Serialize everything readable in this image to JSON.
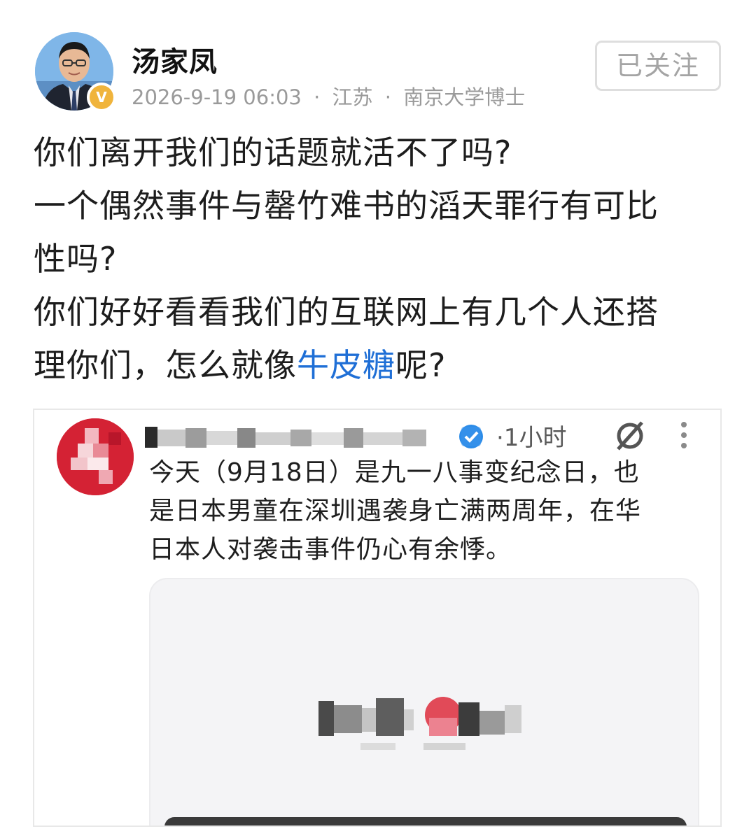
{
  "author": {
    "name": "汤家凤",
    "verified_badge": "V",
    "date": "2026-9-19 06:03",
    "separator": "·",
    "location": "江苏",
    "title": "南京大学博士",
    "follow_label": "已关注"
  },
  "post": {
    "lines": [
      "你们离开我们的话题就活不了吗?",
      "一个偶然事件与罄竹难书的滔天罪行有可比",
      "性吗?",
      "你们好好看看我们的互联网上有几个人还搭"
    ],
    "last_line_prefix": "理你们，怎么就像",
    "topic_link": "牛皮糖",
    "last_line_suffix": "呢?"
  },
  "embed": {
    "time": "·1小时",
    "text_lines": [
      "今天（9月18日）是九一八事变纪念日，也",
      "是日本男童在深圳遇袭身亡满两周年，在华",
      "日本人对袭击事件仍心有余悸。"
    ],
    "icons": {
      "verified": "verified-check-icon",
      "mute": "mute-icon",
      "more": "more-vertical-icon"
    }
  },
  "colors": {
    "topic_link": "#1f6fd6",
    "verified_badge": "#f0b43c",
    "embed_avatar": "#d61f32",
    "meta_text": "#9a9a9a"
  }
}
